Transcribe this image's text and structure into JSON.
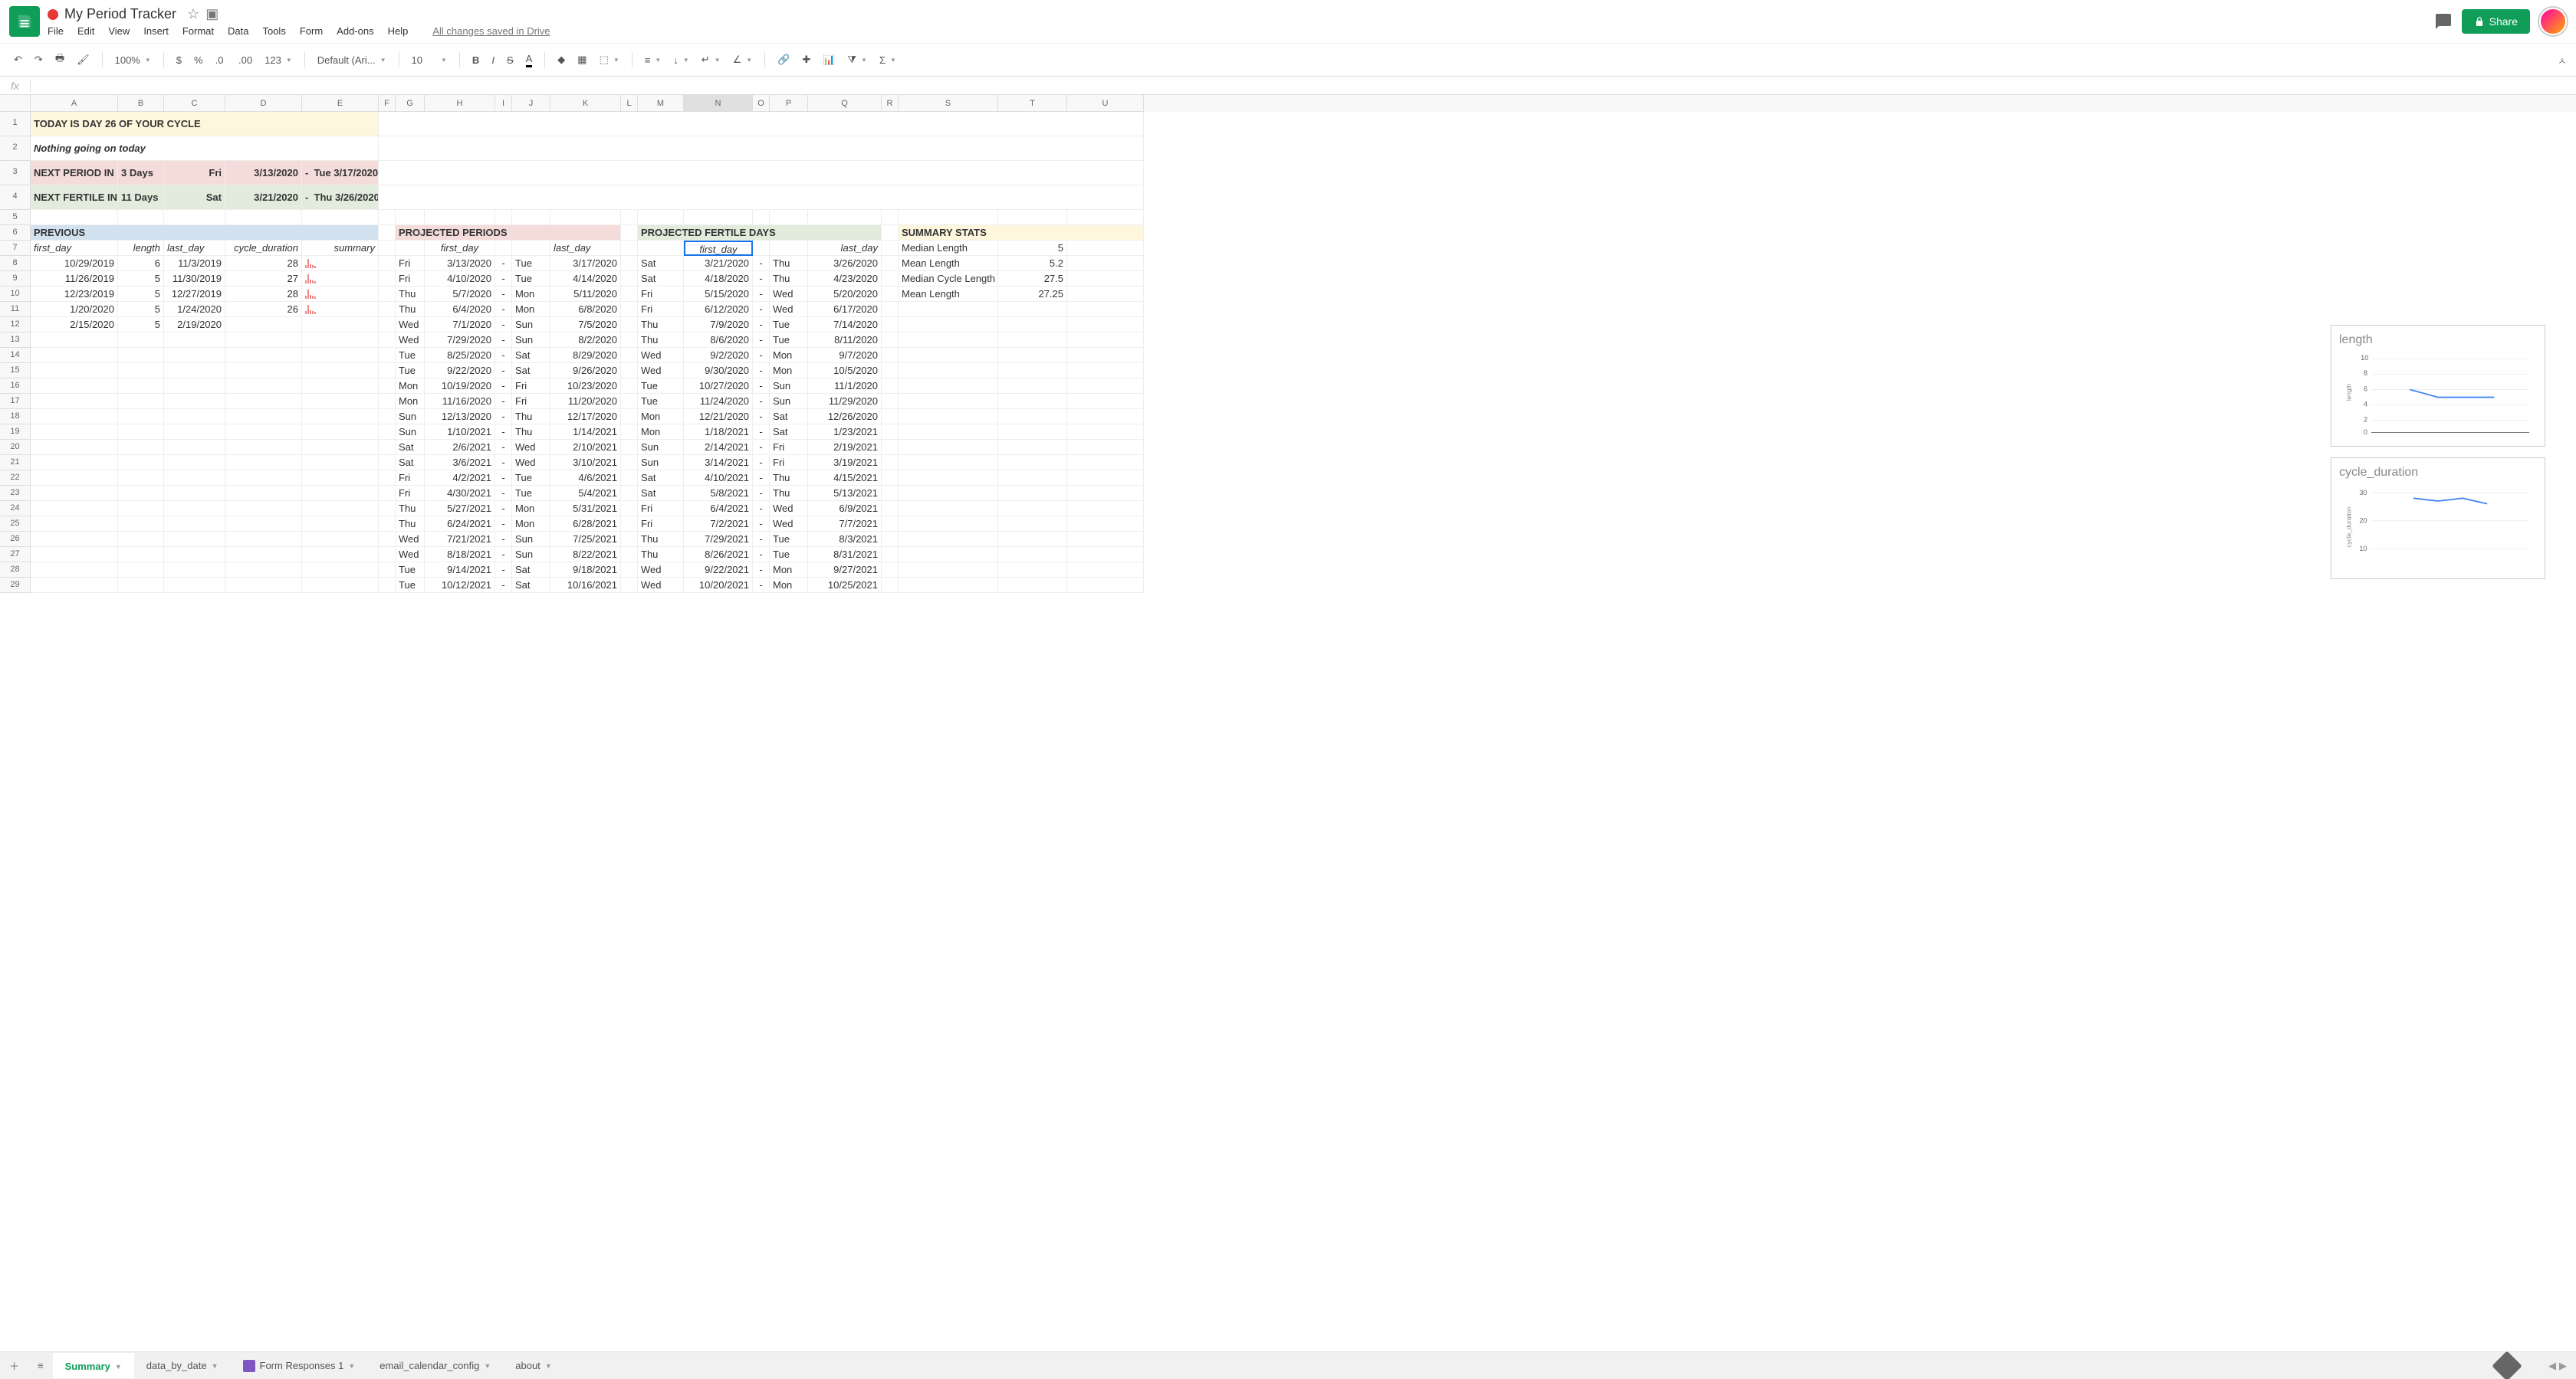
{
  "doc": {
    "title": "My Period Tracker",
    "save_status": "All changes saved in Drive"
  },
  "menus": [
    "File",
    "Edit",
    "View",
    "Insert",
    "Format",
    "Data",
    "Tools",
    "Form",
    "Add-ons",
    "Help"
  ],
  "share": "Share",
  "toolbar": {
    "zoom": "100%",
    "font": "Default (Ari...",
    "size": "10"
  },
  "columns": [
    {
      "l": "",
      "w": 40
    },
    {
      "l": "A",
      "w": 114
    },
    {
      "l": "B",
      "w": 60
    },
    {
      "l": "C",
      "w": 80
    },
    {
      "l": "D",
      "w": 100
    },
    {
      "l": "E",
      "w": 100
    },
    {
      "l": "F",
      "w": 22
    },
    {
      "l": "G",
      "w": 38
    },
    {
      "l": "H",
      "w": 92
    },
    {
      "l": "I",
      "w": 22
    },
    {
      "l": "J",
      "w": 50
    },
    {
      "l": "K",
      "w": 92
    },
    {
      "l": "L",
      "w": 22
    },
    {
      "l": "M",
      "w": 60
    },
    {
      "l": "N",
      "w": 90
    },
    {
      "l": "O",
      "w": 22
    },
    {
      "l": "P",
      "w": 50
    },
    {
      "l": "Q",
      "w": 96
    },
    {
      "l": "R",
      "w": 22
    },
    {
      "l": "S",
      "w": 130
    },
    {
      "l": "T",
      "w": 90
    },
    {
      "l": "U",
      "w": 100
    }
  ],
  "today_banner": "TODAY IS DAY 26 OF YOUR CYCLE",
  "nothing": "Nothing going on today",
  "next_period": {
    "label": "NEXT PERIOD IN",
    "in": "3 Days",
    "dow1": "Fri",
    "d1": "3/13/2020",
    "dash": "-",
    "dow2": "Tue",
    "d2": "3/17/2020"
  },
  "next_fertile": {
    "label": "NEXT FERTILE  IN",
    "in": "11 Days",
    "dow1": "Sat",
    "d1": "3/21/2020",
    "dash": "-",
    "dow2": "Thu",
    "d2": "3/26/2020"
  },
  "previous": {
    "title": "PREVIOUS",
    "headers": {
      "first": "first_day",
      "length": "length",
      "last": "last_day",
      "cycle": "cycle_duration",
      "summary": "summary"
    },
    "rows": [
      {
        "first": "10/29/2019",
        "len": "6",
        "last": "11/3/2019",
        "cycle": "28"
      },
      {
        "first": "11/26/2019",
        "len": "5",
        "last": "11/30/2019",
        "cycle": "27"
      },
      {
        "first": "12/23/2019",
        "len": "5",
        "last": "12/27/2019",
        "cycle": "28"
      },
      {
        "first": "1/20/2020",
        "len": "5",
        "last": "1/24/2020",
        "cycle": "26"
      },
      {
        "first": "2/15/2020",
        "len": "5",
        "last": "2/19/2020",
        "cycle": ""
      }
    ]
  },
  "proj_periods": {
    "title": "PROJECTED PERIODS",
    "headers": {
      "first": "first_day",
      "last": "last_day"
    },
    "rows": [
      {
        "d1": "Fri",
        "f": "3/13/2020",
        "d2": "Tue",
        "l": "3/17/2020"
      },
      {
        "d1": "Fri",
        "f": "4/10/2020",
        "d2": "Tue",
        "l": "4/14/2020"
      },
      {
        "d1": "Thu",
        "f": "5/7/2020",
        "d2": "Mon",
        "l": "5/11/2020"
      },
      {
        "d1": "Thu",
        "f": "6/4/2020",
        "d2": "Mon",
        "l": "6/8/2020"
      },
      {
        "d1": "Wed",
        "f": "7/1/2020",
        "d2": "Sun",
        "l": "7/5/2020"
      },
      {
        "d1": "Wed",
        "f": "7/29/2020",
        "d2": "Sun",
        "l": "8/2/2020"
      },
      {
        "d1": "Tue",
        "f": "8/25/2020",
        "d2": "Sat",
        "l": "8/29/2020"
      },
      {
        "d1": "Tue",
        "f": "9/22/2020",
        "d2": "Sat",
        "l": "9/26/2020"
      },
      {
        "d1": "Mon",
        "f": "10/19/2020",
        "d2": "Fri",
        "l": "10/23/2020"
      },
      {
        "d1": "Mon",
        "f": "11/16/2020",
        "d2": "Fri",
        "l": "11/20/2020"
      },
      {
        "d1": "Sun",
        "f": "12/13/2020",
        "d2": "Thu",
        "l": "12/17/2020"
      },
      {
        "d1": "Sun",
        "f": "1/10/2021",
        "d2": "Thu",
        "l": "1/14/2021"
      },
      {
        "d1": "Sat",
        "f": "2/6/2021",
        "d2": "Wed",
        "l": "2/10/2021"
      },
      {
        "d1": "Sat",
        "f": "3/6/2021",
        "d2": "Wed",
        "l": "3/10/2021"
      },
      {
        "d1": "Fri",
        "f": "4/2/2021",
        "d2": "Tue",
        "l": "4/6/2021"
      },
      {
        "d1": "Fri",
        "f": "4/30/2021",
        "d2": "Tue",
        "l": "5/4/2021"
      },
      {
        "d1": "Thu",
        "f": "5/27/2021",
        "d2": "Mon",
        "l": "5/31/2021"
      },
      {
        "d1": "Thu",
        "f": "6/24/2021",
        "d2": "Mon",
        "l": "6/28/2021"
      },
      {
        "d1": "Wed",
        "f": "7/21/2021",
        "d2": "Sun",
        "l": "7/25/2021"
      },
      {
        "d1": "Wed",
        "f": "8/18/2021",
        "d2": "Sun",
        "l": "8/22/2021"
      },
      {
        "d1": "Tue",
        "f": "9/14/2021",
        "d2": "Sat",
        "l": "9/18/2021"
      },
      {
        "d1": "Tue",
        "f": "10/12/2021",
        "d2": "Sat",
        "l": "10/16/2021"
      }
    ]
  },
  "proj_fertile": {
    "title": "PROJECTED FERTILE DAYS",
    "headers": {
      "first": "first_day",
      "last": "last_day"
    },
    "rows": [
      {
        "d1": "Sat",
        "f": "3/21/2020",
        "d2": "Thu",
        "l": "3/26/2020"
      },
      {
        "d1": "Sat",
        "f": "4/18/2020",
        "d2": "Thu",
        "l": "4/23/2020"
      },
      {
        "d1": "Fri",
        "f": "5/15/2020",
        "d2": "Wed",
        "l": "5/20/2020"
      },
      {
        "d1": "Fri",
        "f": "6/12/2020",
        "d2": "Wed",
        "l": "6/17/2020"
      },
      {
        "d1": "Thu",
        "f": "7/9/2020",
        "d2": "Tue",
        "l": "7/14/2020"
      },
      {
        "d1": "Thu",
        "f": "8/6/2020",
        "d2": "Tue",
        "l": "8/11/2020"
      },
      {
        "d1": "Wed",
        "f": "9/2/2020",
        "d2": "Mon",
        "l": "9/7/2020"
      },
      {
        "d1": "Wed",
        "f": "9/30/2020",
        "d2": "Mon",
        "l": "10/5/2020"
      },
      {
        "d1": "Tue",
        "f": "10/27/2020",
        "d2": "Sun",
        "l": "11/1/2020"
      },
      {
        "d1": "Tue",
        "f": "11/24/2020",
        "d2": "Sun",
        "l": "11/29/2020"
      },
      {
        "d1": "Mon",
        "f": "12/21/2020",
        "d2": "Sat",
        "l": "12/26/2020"
      },
      {
        "d1": "Mon",
        "f": "1/18/2021",
        "d2": "Sat",
        "l": "1/23/2021"
      },
      {
        "d1": "Sun",
        "f": "2/14/2021",
        "d2": "Fri",
        "l": "2/19/2021"
      },
      {
        "d1": "Sun",
        "f": "3/14/2021",
        "d2": "Fri",
        "l": "3/19/2021"
      },
      {
        "d1": "Sat",
        "f": "4/10/2021",
        "d2": "Thu",
        "l": "4/15/2021"
      },
      {
        "d1": "Sat",
        "f": "5/8/2021",
        "d2": "Thu",
        "l": "5/13/2021"
      },
      {
        "d1": "Fri",
        "f": "6/4/2021",
        "d2": "Wed",
        "l": "6/9/2021"
      },
      {
        "d1": "Fri",
        "f": "7/2/2021",
        "d2": "Wed",
        "l": "7/7/2021"
      },
      {
        "d1": "Thu",
        "f": "7/29/2021",
        "d2": "Tue",
        "l": "8/3/2021"
      },
      {
        "d1": "Thu",
        "f": "8/26/2021",
        "d2": "Tue",
        "l": "8/31/2021"
      },
      {
        "d1": "Wed",
        "f": "9/22/2021",
        "d2": "Mon",
        "l": "9/27/2021"
      },
      {
        "d1": "Wed",
        "f": "10/20/2021",
        "d2": "Mon",
        "l": "10/25/2021"
      }
    ]
  },
  "summary_stats": {
    "title": "SUMMARY STATS",
    "rows": [
      {
        "l": "Median Length",
        "v": "5"
      },
      {
        "l": "Mean Length",
        "v": "5.2"
      },
      {
        "l": "Median Cycle Length",
        "v": "27.5"
      },
      {
        "l": "Mean Length",
        "v": "27.25"
      }
    ]
  },
  "chart_data": [
    {
      "type": "line",
      "title": "length",
      "ylabel": "length",
      "x": [
        1,
        2,
        3,
        4,
        5
      ],
      "y": [
        6,
        5,
        5,
        5,
        5
      ],
      "ylim": [
        0,
        10
      ],
      "yticks": [
        0,
        2,
        4,
        6,
        8,
        10
      ]
    },
    {
      "type": "line",
      "title": "cycle_duration",
      "ylabel": "cycle_duration",
      "x": [
        1,
        2,
        3,
        4
      ],
      "y": [
        28,
        27,
        28,
        26
      ],
      "ylim": [
        0,
        30
      ],
      "yticks": [
        10,
        20,
        30
      ]
    }
  ],
  "tabs": [
    "Summary",
    "data_by_date",
    "Form Responses 1",
    "email_calendar_config",
    "about"
  ],
  "active_tab": 0
}
